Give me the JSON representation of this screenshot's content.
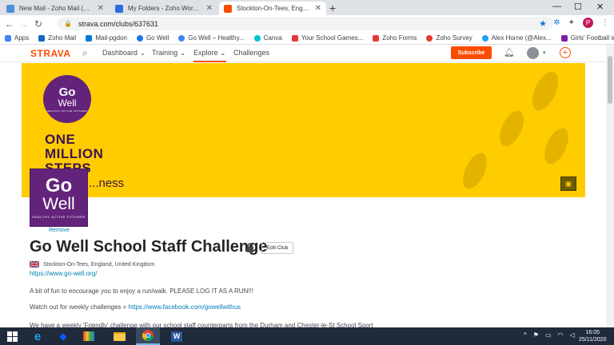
{
  "browser": {
    "tabs": [
      {
        "title": "New Mail - Zoho Mail (pauldonc",
        "favicon_color": "#4a8fd8",
        "active": false
      },
      {
        "title": "My Folders - Zoho WorkDrive",
        "favicon_color": "#2d6cdf",
        "active": false
      },
      {
        "title": "Stockton-On-Tees, England, Unit",
        "favicon_color": "#fc4c02",
        "active": true
      }
    ],
    "new_tab": "+",
    "url": "strava.com/clubs/637631",
    "profile_initial": "P",
    "bookmarks": [
      {
        "label": "Apps",
        "color": "#4285f4"
      },
      {
        "label": "Zoho Mail",
        "color": "#1565c0"
      },
      {
        "label": "Mail-pgdon",
        "color": "#0078d4"
      },
      {
        "label": "Go Well",
        "color": "#1877f2"
      },
      {
        "label": "Go Well – Healthy...",
        "color": "#4285f4"
      },
      {
        "label": "Canva",
        "color": "#00c4cc"
      },
      {
        "label": "Your School Games...",
        "color": "#e53935"
      },
      {
        "label": "Zoho Forms",
        "color": "#e53935"
      },
      {
        "label": "Zoho Survey",
        "color": "#e53935"
      },
      {
        "label": "Alex Horne (@Alex...",
        "color": "#1da1f2"
      },
      {
        "label": "Girls' Football in Sc...",
        "color": "#7b1fa2"
      }
    ]
  },
  "strava": {
    "logo": "STRAVA",
    "nav": [
      {
        "label": "Dashboard",
        "dropdown": true,
        "selected": false
      },
      {
        "label": "Training",
        "dropdown": true,
        "selected": false
      },
      {
        "label": "Explore",
        "dropdown": true,
        "selected": true
      },
      {
        "label": "Challenges",
        "dropdown": false,
        "selected": false
      }
    ],
    "subscribe_label": "Subscribe",
    "accent": "#fc4c02"
  },
  "banner": {
    "bg_color": "#ffcc00",
    "logo_go": "Go",
    "logo_well": "Well",
    "logo_tag": "HEALTHY ACTIVE FUTURES",
    "line1": "ONE",
    "line2": "MILLION",
    "line3": "STEPS",
    "line4": "...ness"
  },
  "club": {
    "avatar_go": "Go",
    "avatar_well": "Well",
    "avatar_tag": "HEALTHY ACTIVE FUTURES",
    "remove_label": "Remove",
    "name": "Go Well School Staff Challenge",
    "edit_label": "Edit Club",
    "location": "Stockton-On-Tees, England, United Kingdom",
    "website": "https://www.go-well.org/",
    "description_1": "A bit of fun to encourage you to enjoy a run/walk. PLEASE LOG IT AS A RUN!!!",
    "description_2_prefix": "Watch out for weekly challenges = ",
    "description_2_link": "https://www.facebook.com/gowellwithus",
    "description_3": "We have a weekly 'Friendly' challenge with our school staff counterparts from the Durham and Chester-le-St School Sport"
  },
  "taskbar": {
    "time": "16:05",
    "date": "25/11/2020"
  }
}
